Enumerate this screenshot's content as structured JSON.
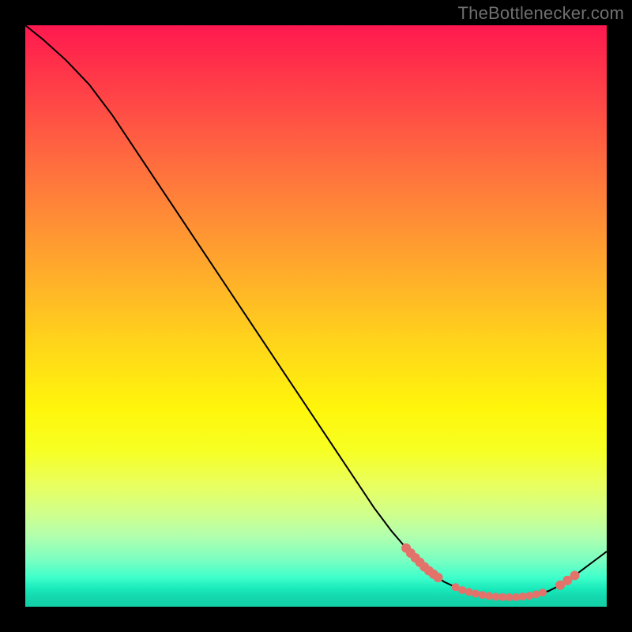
{
  "watermark": "TheBottlenecker.com",
  "chart_data": {
    "type": "line",
    "title": "",
    "xlabel": "",
    "ylabel": "",
    "xlim": [
      0,
      100
    ],
    "ylim": [
      0,
      100
    ],
    "series": [
      {
        "name": "curve",
        "points": [
          {
            "x": 0.0,
            "y": 100.0
          },
          {
            "x": 3.0,
            "y": 97.6
          },
          {
            "x": 7.0,
            "y": 94.0
          },
          {
            "x": 11.0,
            "y": 89.8
          },
          {
            "x": 15.0,
            "y": 84.5
          },
          {
            "x": 20.0,
            "y": 77.0
          },
          {
            "x": 25.0,
            "y": 69.5
          },
          {
            "x": 30.0,
            "y": 62.0
          },
          {
            "x": 35.0,
            "y": 54.5
          },
          {
            "x": 40.0,
            "y": 47.0
          },
          {
            "x": 45.0,
            "y": 39.5
          },
          {
            "x": 50.0,
            "y": 32.0
          },
          {
            "x": 55.0,
            "y": 24.5
          },
          {
            "x": 60.0,
            "y": 17.0
          },
          {
            "x": 63.0,
            "y": 13.0
          },
          {
            "x": 66.0,
            "y": 9.5
          },
          {
            "x": 69.0,
            "y": 6.5
          },
          {
            "x": 72.0,
            "y": 4.3
          },
          {
            "x": 75.0,
            "y": 2.9
          },
          {
            "x": 78.0,
            "y": 2.1
          },
          {
            "x": 81.0,
            "y": 1.7
          },
          {
            "x": 84.0,
            "y": 1.6
          },
          {
            "x": 87.0,
            "y": 1.9
          },
          {
            "x": 90.0,
            "y": 2.7
          },
          {
            "x": 92.0,
            "y": 3.7
          },
          {
            "x": 94.0,
            "y": 5.0
          },
          {
            "x": 96.0,
            "y": 6.5
          },
          {
            "x": 98.0,
            "y": 8.0
          },
          {
            "x": 100.0,
            "y": 9.5
          }
        ]
      }
    ],
    "dotted_segments": [
      {
        "name": "left-seg",
        "x_start": 65.5,
        "x_end": 71.0,
        "count": 8,
        "radius": 6
      },
      {
        "name": "trough-seg",
        "x_start": 74.0,
        "x_end": 89.0,
        "count": 14,
        "radius": 5
      },
      {
        "name": "right-seg",
        "x_start": 92.0,
        "x_end": 94.5,
        "count": 3,
        "radius": 6
      }
    ],
    "background_gradient": {
      "top_color": "#ff1850",
      "bottom_color": "#12cfa6"
    }
  }
}
